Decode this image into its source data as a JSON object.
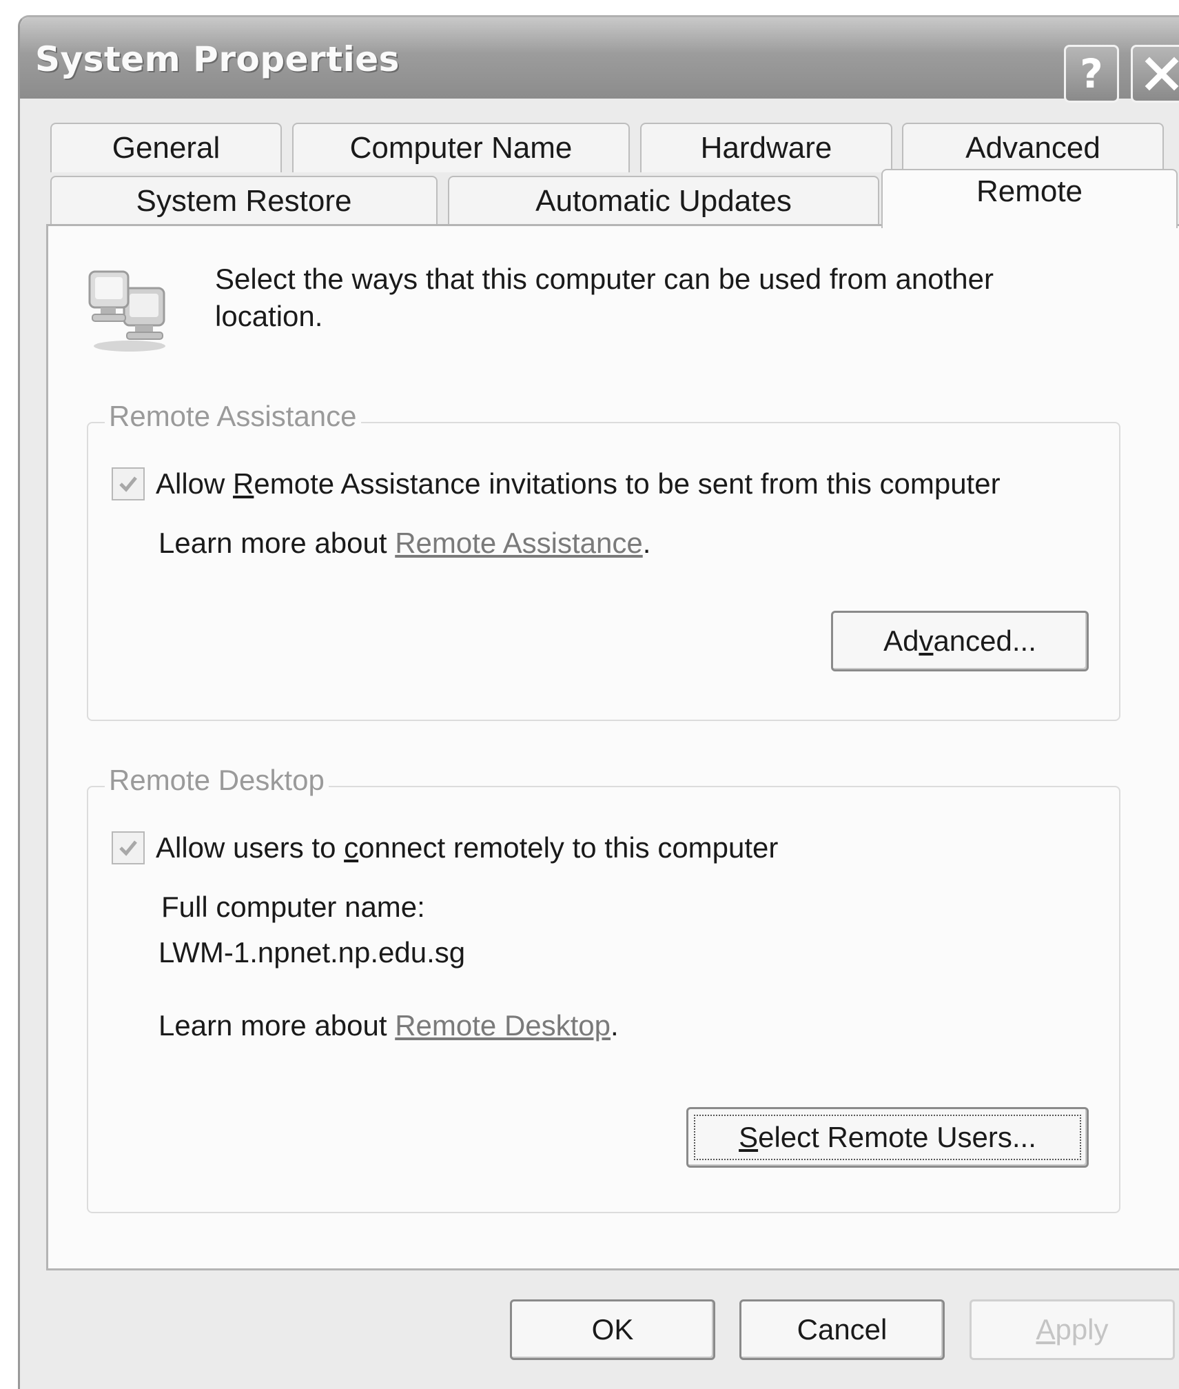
{
  "window": {
    "title": "System Properties",
    "help_glyph": "?",
    "close_glyph": "✕"
  },
  "tabs": {
    "row1": [
      "General",
      "Computer Name",
      "Hardware",
      "Advanced"
    ],
    "row2": [
      "System Restore",
      "Automatic Updates",
      "Remote"
    ],
    "active": "Remote"
  },
  "intro": {
    "icon": "network-computers-icon",
    "text": "Select the ways that this computer can be used from another location."
  },
  "remote_assistance": {
    "group_label": "Remote Assistance",
    "checkbox_label_pre": "Allow ",
    "checkbox_label_mnemonic": "R",
    "checkbox_label_post": "emote Assistance invitations to be sent from this computer",
    "checked": true,
    "learn_more_prefix": "Learn more about ",
    "learn_more_link": "Remote Assistance",
    "learn_more_suffix": ".",
    "advanced_button_pre": "Ad",
    "advanced_button_mnemonic": "v",
    "advanced_button_post": "anced..."
  },
  "remote_desktop": {
    "group_label": "Remote Desktop",
    "checkbox_label_pre": "Allow users to ",
    "checkbox_label_mnemonic": "c",
    "checkbox_label_post": "onnect remotely to this computer",
    "checked": true,
    "computer_name_label": "Full computer name:",
    "computer_name_value": "LWM-1.npnet.np.edu.sg",
    "learn_more_prefix": "Learn more about ",
    "learn_more_link": "Remote Desktop",
    "learn_more_suffix": ".",
    "select_users_mnemonic": "S",
    "select_users_post": "elect Remote Users..."
  },
  "footer": {
    "ok_label": "OK",
    "cancel_label": "Cancel",
    "apply_pre": "",
    "apply_mnemonic": "A",
    "apply_post": "pply"
  },
  "colors": {
    "titlebar_top": "#c9c9c9",
    "titlebar_bottom": "#8c8c8c",
    "panel_bg": "#fbfbfb",
    "disabled_text": "#9a9a9a",
    "link_text": "#7a7a7a"
  }
}
